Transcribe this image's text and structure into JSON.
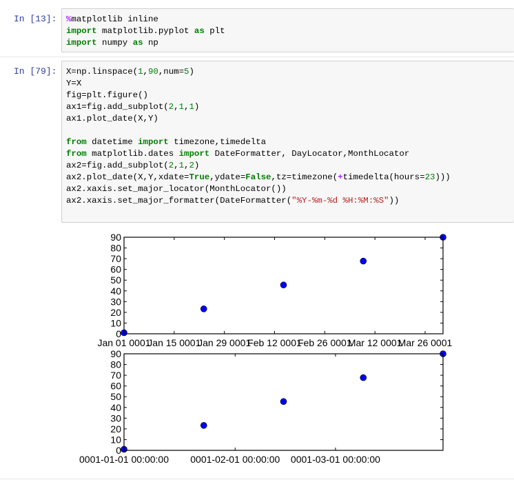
{
  "cells": [
    {
      "prompt": "In  [13]:",
      "lines": [
        [
          {
            "t": "%",
            "c": "mg"
          },
          {
            "t": "matplotlib inline",
            "c": ""
          }
        ],
        [
          {
            "t": "import",
            "c": "kw"
          },
          {
            "t": " matplotlib.pyplot ",
            "c": ""
          },
          {
            "t": "as",
            "c": "kw"
          },
          {
            "t": " plt",
            "c": ""
          }
        ],
        [
          {
            "t": "import",
            "c": "kw"
          },
          {
            "t": " numpy ",
            "c": ""
          },
          {
            "t": "as",
            "c": "kw"
          },
          {
            "t": " np",
            "c": ""
          }
        ]
      ]
    },
    {
      "prompt": "In  [79]:",
      "lines": [
        [
          {
            "t": "X=np.linspace(",
            "c": ""
          },
          {
            "t": "1",
            "c": "num-lit"
          },
          {
            "t": ",",
            "c": ""
          },
          {
            "t": "90",
            "c": "num-lit"
          },
          {
            "t": ",num=",
            "c": ""
          },
          {
            "t": "5",
            "c": "num-lit"
          },
          {
            "t": ")",
            "c": ""
          }
        ],
        [
          {
            "t": "Y=X",
            "c": ""
          }
        ],
        [
          {
            "t": "fig=plt.figure()",
            "c": ""
          }
        ],
        [
          {
            "t": "ax1=fig.add_subplot(",
            "c": ""
          },
          {
            "t": "2",
            "c": "num-lit"
          },
          {
            "t": ",",
            "c": ""
          },
          {
            "t": "1",
            "c": "num-lit"
          },
          {
            "t": ",",
            "c": ""
          },
          {
            "t": "1",
            "c": "num-lit"
          },
          {
            "t": ")",
            "c": ""
          }
        ],
        [
          {
            "t": "ax1.plot_date(X,Y)",
            "c": ""
          }
        ],
        [
          {
            "t": "",
            "c": ""
          }
        ],
        [
          {
            "t": "from",
            "c": "kw"
          },
          {
            "t": " datetime ",
            "c": ""
          },
          {
            "t": "import",
            "c": "kw"
          },
          {
            "t": " timezone,timedelta",
            "c": ""
          }
        ],
        [
          {
            "t": "from",
            "c": "kw"
          },
          {
            "t": " matplotlib.dates ",
            "c": ""
          },
          {
            "t": "import",
            "c": "kw"
          },
          {
            "t": " DateFormatter, DayLocator,MonthLocator",
            "c": ""
          }
        ],
        [
          {
            "t": "ax2=fig.add_subplot(",
            "c": ""
          },
          {
            "t": "2",
            "c": "num-lit"
          },
          {
            "t": ",",
            "c": ""
          },
          {
            "t": "1",
            "c": "num-lit"
          },
          {
            "t": ",",
            "c": ""
          },
          {
            "t": "2",
            "c": "num-lit"
          },
          {
            "t": ")",
            "c": ""
          }
        ],
        [
          {
            "t": "ax2.plot_date(X,Y,xdate=",
            "c": ""
          },
          {
            "t": "True",
            "c": "kw"
          },
          {
            "t": ",ydate=",
            "c": ""
          },
          {
            "t": "False",
            "c": "kw"
          },
          {
            "t": ",tz=timezone(",
            "c": ""
          },
          {
            "t": "+",
            "c": "mg"
          },
          {
            "t": "timedelta(hours=",
            "c": ""
          },
          {
            "t": "23",
            "c": "num-lit"
          },
          {
            "t": ")))",
            "c": ""
          }
        ],
        [
          {
            "t": "ax2.xaxis.set_major_locator(MonthLocator())",
            "c": ""
          }
        ],
        [
          {
            "t": "ax2.xaxis.set_major_formatter(DateFormatter(",
            "c": ""
          },
          {
            "t": "\"%Y-%m-%d %H:%M:%S\"",
            "c": "str"
          },
          {
            "t": "))",
            "c": ""
          }
        ]
      ]
    }
  ],
  "chart_data": [
    {
      "type": "scatter",
      "x": [
        1,
        23.25,
        45.5,
        67.75,
        90
      ],
      "y": [
        1,
        23.25,
        45.5,
        67.75,
        90
      ],
      "xlim": [
        1,
        90
      ],
      "ylim": [
        0,
        90
      ],
      "yticks": [
        "0",
        "10",
        "20",
        "30",
        "40",
        "50",
        "60",
        "70",
        "80",
        "90"
      ],
      "xtick_values": [
        1,
        15,
        29,
        43,
        57,
        71,
        85
      ],
      "xtick_labels": [
        "Jan 01 0001",
        "Jan 15 0001",
        "Jan 29 0001",
        "Feb 12 0001",
        "Feb 26 0001",
        "Mar 12 0001",
        "Mar 26 0001"
      ],
      "marker_color": "#0000ff"
    },
    {
      "type": "scatter",
      "x": [
        1,
        23.25,
        45.5,
        67.75,
        90
      ],
      "y": [
        1,
        23.25,
        45.5,
        67.75,
        90
      ],
      "xlim": [
        1,
        90
      ],
      "ylim": [
        0,
        90
      ],
      "yticks": [
        "0",
        "10",
        "20",
        "30",
        "40",
        "50",
        "60",
        "70",
        "80",
        "90"
      ],
      "xtick_values": [
        1,
        32,
        60
      ],
      "xtick_labels": [
        "0001-01-01 00:00:00",
        "0001-02-01 00:00:00",
        "0001-03-01 00:00:00"
      ],
      "marker_color": "#0000ff"
    }
  ]
}
